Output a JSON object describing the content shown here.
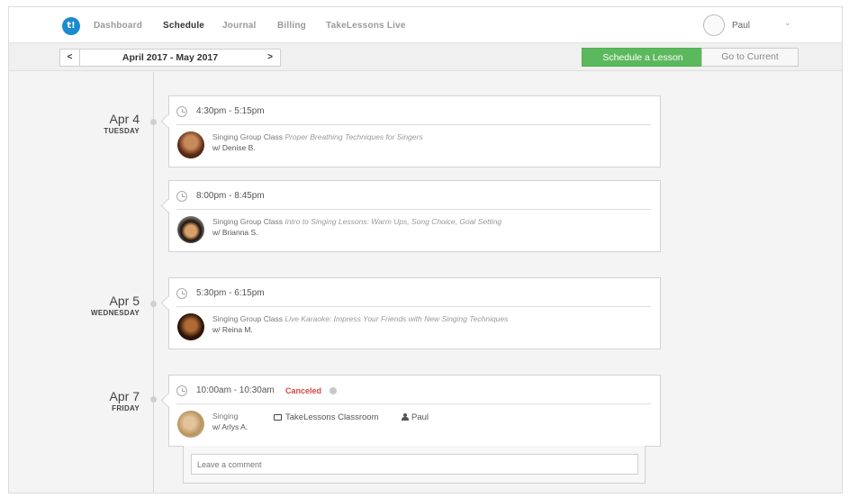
{
  "nav": {
    "logo_text": "t!",
    "links": [
      "Dashboard",
      "Schedule",
      "Journal",
      "Billing",
      "TakeLessons Live"
    ],
    "active": "Schedule",
    "user_name": "Paul",
    "user_chevron": "⌄"
  },
  "subbar": {
    "prev": "<",
    "next": ">",
    "range": "April 2017 - May 2017",
    "schedule_button": "Schedule a Lesson",
    "current_button": "Go to Current",
    "schedule_button_color": "#5cb85c"
  },
  "days": [
    {
      "date": "Apr 4",
      "weekday": "TUESDAY"
    },
    {
      "date": "Apr 5",
      "weekday": "WEDNESDAY"
    },
    {
      "date": "Apr 7",
      "weekday": "FRIDAY"
    }
  ],
  "lessons": [
    {
      "time": "4:30pm - 5:15pm",
      "subject": "Singing Group Class",
      "title": "Proper Breathing Techniques for Singers",
      "teacher": "w/ Denise B.",
      "avatar": "teacher-avatar"
    },
    {
      "time": "8:00pm - 8:45pm",
      "subject": "Singing Group Class",
      "title": "Intro to Singing Lessons: Warm Ups, Song Choice, Goal Setting",
      "teacher": "w/ Brianna S.",
      "avatar": "teacher-avatar"
    },
    {
      "time": "5:30pm - 6:15pm",
      "subject": "Singing Group Class",
      "title": "Live Karaoke: Impress Your Friends with New Singing Techniques",
      "teacher": "w/ Reina M.",
      "avatar": "teacher-avatar"
    },
    {
      "time": "10:00am - 10:30am",
      "status": "Canceled",
      "subject": "Singing",
      "teacher": "w/ Arlys A.",
      "location": "TakeLessons Classroom",
      "student": "Paul",
      "avatar": "teacher-avatar"
    }
  ],
  "comment": {
    "placeholder": "Leave a comment"
  },
  "colors": {
    "canceled": "#d9463d",
    "brand": "#1b8bd0"
  }
}
